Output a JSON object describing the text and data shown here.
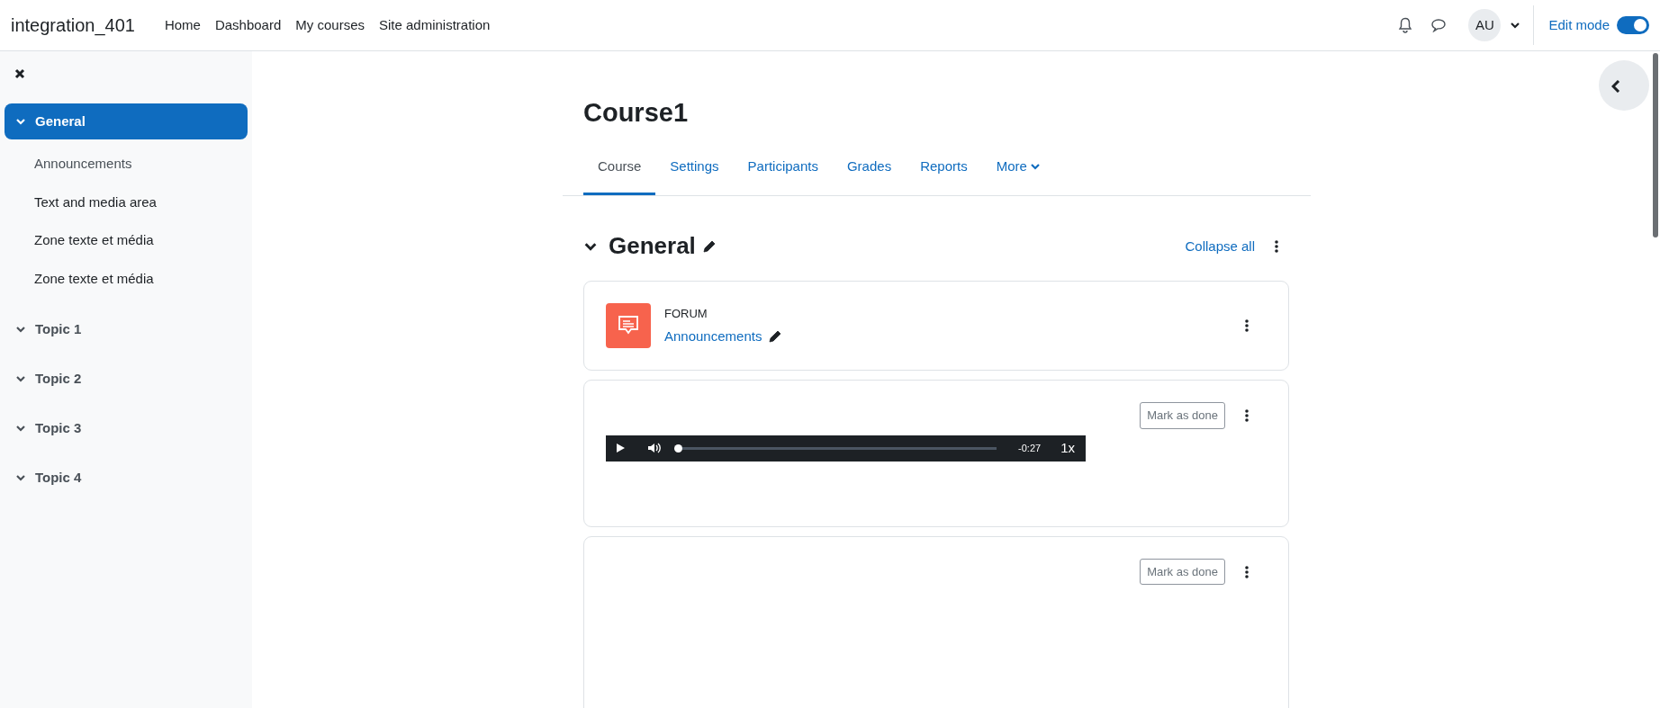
{
  "navbar": {
    "site_name": "integration_401",
    "links": [
      "Home",
      "Dashboard",
      "My courses",
      "Site administration"
    ],
    "avatar": "AU",
    "edit_mode": {
      "label": "Edit mode",
      "on": true
    }
  },
  "course_index": {
    "sections": [
      {
        "title": "General",
        "selected": true,
        "expanded": true,
        "items": [
          {
            "label": "Announcements",
            "muted": true
          },
          {
            "label": "Text and media area",
            "muted": false
          },
          {
            "label": "Zone texte et média",
            "muted": false
          },
          {
            "label": "Zone texte et média",
            "muted": false
          }
        ]
      },
      {
        "title": "Topic 1",
        "selected": false,
        "expanded": true
      },
      {
        "title": "Topic 2",
        "selected": false,
        "expanded": true
      },
      {
        "title": "Topic 3",
        "selected": false,
        "expanded": true
      },
      {
        "title": "Topic 4",
        "selected": false,
        "expanded": true
      }
    ]
  },
  "course": {
    "title": "Course1",
    "tabs": [
      {
        "label": "Course",
        "selected": true
      },
      {
        "label": "Settings",
        "selected": false
      },
      {
        "label": "Participants",
        "selected": false
      },
      {
        "label": "Grades",
        "selected": false
      },
      {
        "label": "Reports",
        "selected": false
      },
      {
        "label": "More",
        "selected": false,
        "dropdown": true
      }
    ]
  },
  "section": {
    "title": "General",
    "expanded": true,
    "collapse_all": "Collapse all"
  },
  "activities": [
    {
      "kind": "forum",
      "type_label": "FORUM",
      "name": "Announcements"
    },
    {
      "kind": "audio",
      "completion": "Mark as done",
      "player": {
        "time": "-0:27",
        "speed": "1x",
        "level": 0
      }
    },
    {
      "kind": "blank",
      "completion": "Mark as done"
    }
  ]
}
